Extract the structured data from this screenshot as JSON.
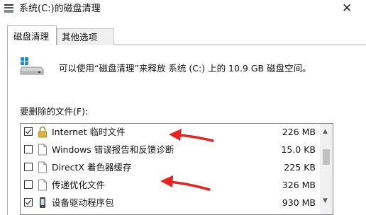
{
  "window": {
    "title": "系统(C:)的磁盘清理",
    "close_glyph": "✕"
  },
  "tabs": [
    {
      "label": "磁盘清理",
      "active": true
    },
    {
      "label": "其他选项",
      "active": false
    }
  ],
  "description": "可以使用“磁盘清理”来释放 系统 (C:) 上的 10.9 GB 磁盘空间。",
  "files_label": "要删除的文件(F):",
  "files": [
    {
      "checked": true,
      "icon": "lock-icon",
      "label": "Internet 临时文件",
      "size": "226 MB"
    },
    {
      "checked": false,
      "icon": "file-icon",
      "label": "Windows 错误报告和反馈诊断",
      "size": "15.0 KB"
    },
    {
      "checked": false,
      "icon": "file-icon",
      "label": "DirectX 着色器缓存",
      "size": "225 KB"
    },
    {
      "checked": false,
      "icon": "file-icon",
      "label": "传递优化文件",
      "size": "326 MB"
    },
    {
      "checked": true,
      "icon": "phone-icon",
      "label": "设备驱动程序包",
      "size": "930 MB"
    }
  ],
  "colors": {
    "annotation_arrow": "#e8231f",
    "selected_border": "#adadad"
  }
}
